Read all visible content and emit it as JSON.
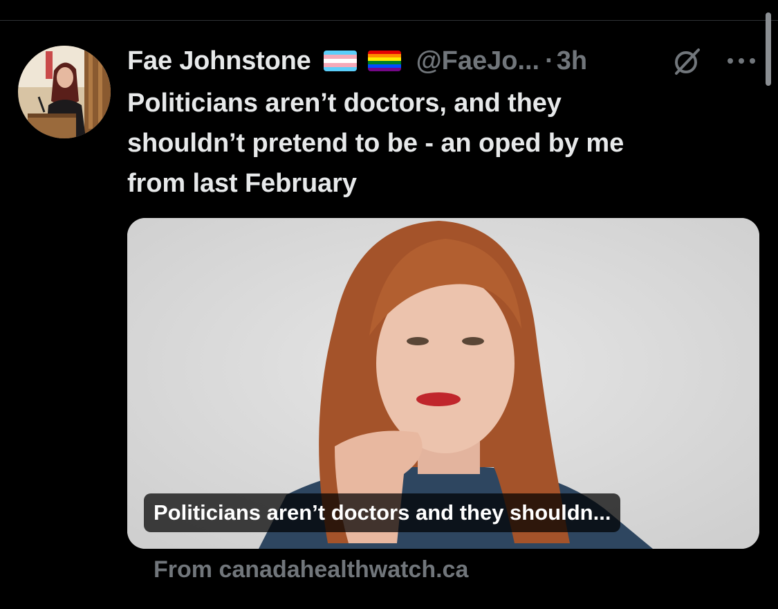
{
  "post": {
    "author": {
      "display_name": "Fae Johnstone",
      "handle": "@FaeJo...",
      "flags": [
        "transgender-pride-flag",
        "rainbow-pride-flag"
      ],
      "avatar_icon": "author-avatar-photo"
    },
    "separator": "·",
    "timestamp": "3h",
    "text_lines": [
      "Politicians aren’t doctors, and they",
      "shouldn’t pretend to be - an oped by me",
      "from last February"
    ],
    "actions": {
      "grok_icon": "grok-icon",
      "more_icon": "more-options-icon"
    },
    "link_card": {
      "image_icon": "article-photo",
      "caption": "Politicians aren’t doctors and they shouldn...",
      "source": "From canadahealthwatch.ca"
    }
  },
  "colors": {
    "background": "#000000",
    "primary_text": "#e7e9ea",
    "secondary_text": "#71767b",
    "divider": "#2f3336"
  }
}
